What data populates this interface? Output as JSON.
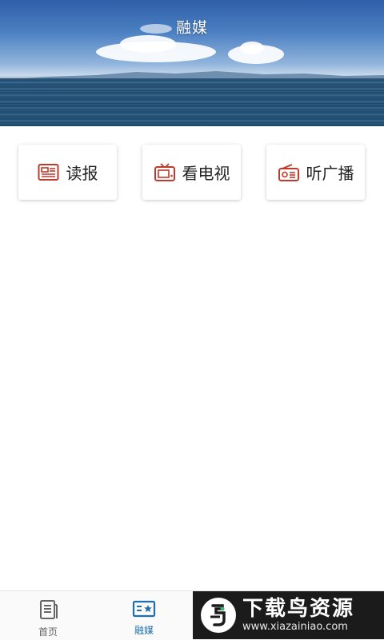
{
  "header": {
    "title": "融媒"
  },
  "media": [
    {
      "label": "读报",
      "icon": "newspaper-icon"
    },
    {
      "label": "看电视",
      "icon": "tv-icon"
    },
    {
      "label": "听广播",
      "icon": "radio-icon"
    }
  ],
  "bottom_nav": [
    {
      "label": "首页",
      "icon": "home-doc-icon",
      "active": false
    },
    {
      "label": "融媒",
      "icon": "media-card-icon",
      "active": true
    }
  ],
  "watermark": {
    "title": "下载鸟资源",
    "url": "www.xiazainiao.com"
  },
  "colors": {
    "accent_red": "#c0392b",
    "nav_active": "#1f6fa8",
    "nav_inactive": "#666666"
  }
}
